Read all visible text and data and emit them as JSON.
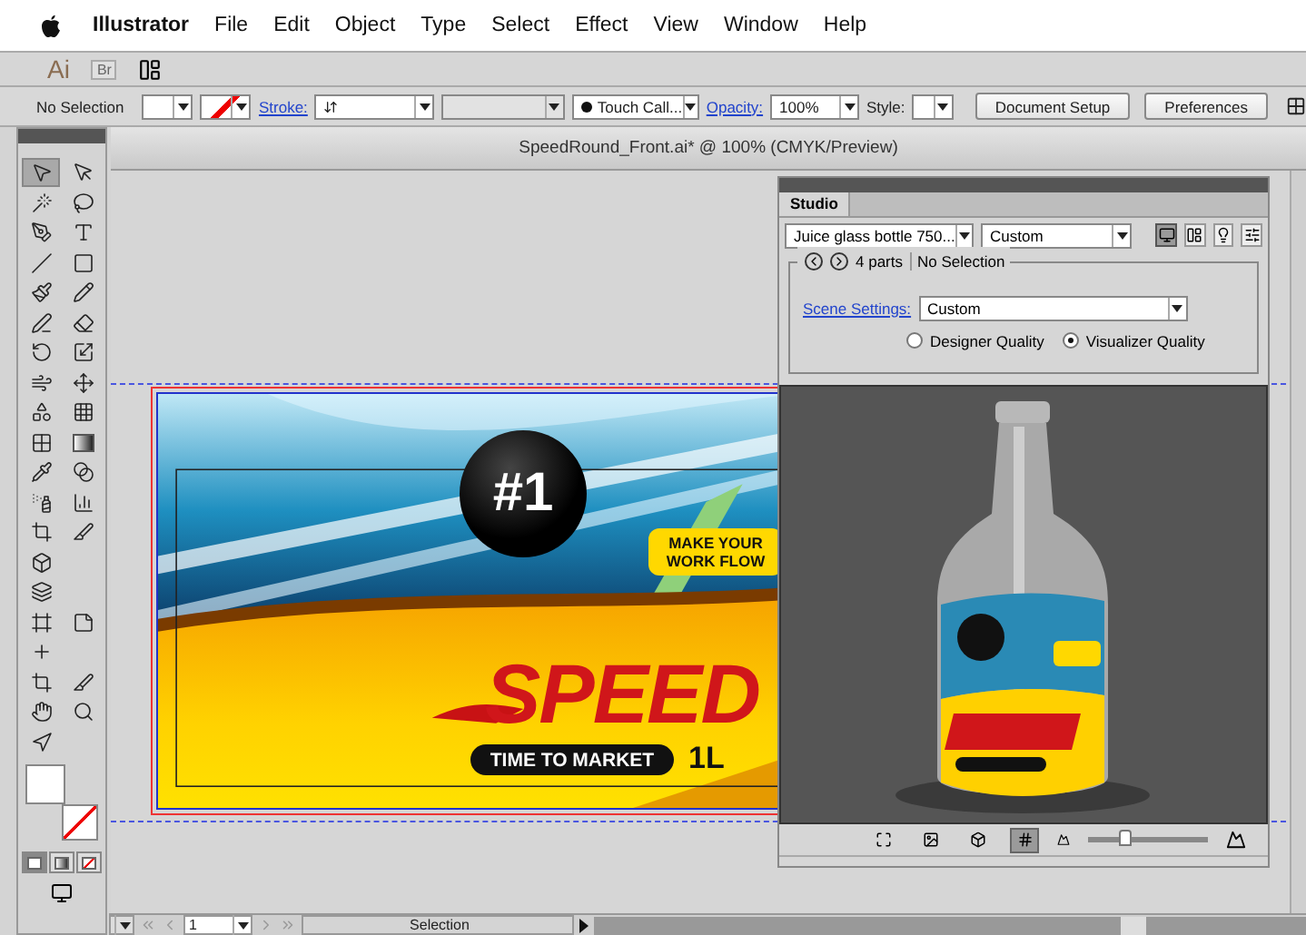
{
  "menu_bar": {
    "app_name": "Illustrator",
    "items": [
      "File",
      "Edit",
      "Object",
      "Type",
      "Select",
      "Effect",
      "View",
      "Window",
      "Help"
    ]
  },
  "app_bar": {
    "logo": "Ai",
    "bridge": "Br"
  },
  "control_bar": {
    "selection": "No Selection",
    "stroke_label": "Stroke:",
    "brush": "Touch Call...",
    "opacity_label": "Opacity:",
    "opacity": "100%",
    "style_label": "Style:",
    "buttons": [
      "Document Setup",
      "Preferences"
    ]
  },
  "tools": [
    {
      "tools": [
        {
          "kind": "selection",
          "selected": true
        },
        {
          "kind": "direct-selection",
          "selected": false
        }
      ]
    },
    {
      "tools": [
        {
          "kind": "magic-wand",
          "selected": false
        },
        {
          "kind": "lasso",
          "selected": false
        }
      ]
    },
    {
      "tools": [
        {
          "kind": "pen",
          "selected": false
        },
        {
          "kind": "type",
          "selected": false
        }
      ]
    },
    {
      "tools": [
        {
          "kind": "line",
          "selected": false
        },
        {
          "kind": "rectangle",
          "selected": false
        }
      ]
    },
    {
      "tools": [
        {
          "kind": "paintbrush",
          "selected": false
        },
        {
          "kind": "pencil",
          "selected": false
        }
      ]
    },
    {
      "tools": [
        {
          "kind": "blob-brush",
          "selected": false
        },
        {
          "kind": "eraser",
          "selected": false
        }
      ]
    },
    {
      "tools": [
        {
          "kind": "rotate",
          "selected": false
        },
        {
          "kind": "scale",
          "selected": false
        }
      ]
    },
    {
      "tools": [
        {
          "kind": "warp",
          "selected": false
        },
        {
          "kind": "free-transform",
          "selected": false
        }
      ]
    },
    {
      "tools": [
        {
          "kind": "shape-builder",
          "selected": false
        },
        {
          "kind": "perspective",
          "selected": false
        }
      ]
    },
    {
      "tools": [
        {
          "kind": "mesh",
          "selected": false
        },
        {
          "kind": "gradient",
          "selected": false
        }
      ]
    },
    {
      "tools": [
        {
          "kind": "eyedropper",
          "selected": false
        },
        {
          "kind": "blend",
          "selected": false
        }
      ]
    },
    {
      "tools": [
        {
          "kind": "symbol-sprayer",
          "selected": false
        },
        {
          "kind": "graph",
          "selected": false
        }
      ]
    },
    {
      "tools": [
        {
          "kind": "artboard-select",
          "selected": false
        },
        {
          "kind": "slice",
          "selected": false
        }
      ]
    },
    {
      "tools": [
        {
          "kind": "cube",
          "selected": false
        }
      ]
    },
    {
      "tools": [
        {
          "kind": "layers",
          "selected": false
        }
      ]
    },
    {
      "tools": [
        {
          "kind": "frame",
          "selected": false
        },
        {
          "kind": "note",
          "selected": false
        }
      ]
    },
    {
      "tools": [
        {
          "kind": "plus",
          "selected": false
        }
      ]
    },
    {
      "tools": [
        {
          "kind": "artboard",
          "selected": false
        },
        {
          "kind": "knife",
          "selected": false
        }
      ]
    },
    {
      "tools": [
        {
          "kind": "hand",
          "selected": false
        },
        {
          "kind": "zoom",
          "selected": false
        }
      ]
    },
    {
      "tools": [
        {
          "kind": "touch",
          "selected": false
        }
      ]
    }
  ],
  "draw_modes": [
    {
      "kind": "normal",
      "selected": true
    },
    {
      "kind": "behind",
      "selected": false
    },
    {
      "kind": "inside",
      "selected": false
    }
  ],
  "document": {
    "tab": "SpeedRound_Front.ai* @ 100% (CMYK/Preview)",
    "artwork": {
      "badge": "#1",
      "tagline": [
        "MAKE YOUR",
        "WORK FLOW"
      ],
      "brand": "SPEED",
      "slogan": "TIME TO MARKET",
      "volume": "1L"
    }
  },
  "studio": {
    "tab": "Studio",
    "model": "Juice glass bottle 750...",
    "preset": "Custom",
    "view_buttons": [
      {
        "kind": "render",
        "selected": true
      },
      {
        "kind": "parts",
        "selected": false
      },
      {
        "kind": "lights",
        "selected": false
      },
      {
        "kind": "settings",
        "selected": false
      }
    ],
    "parts": "4 parts",
    "selection": "No Selection",
    "scene_label": "Scene Settings:",
    "scene": "Custom",
    "quality": [
      {
        "label": "Designer Quality",
        "selected": false
      },
      {
        "label": "Visualizer Quality",
        "selected": true
      }
    ],
    "bottom_tools": [
      {
        "kind": "fit",
        "selected": false
      },
      {
        "kind": "background",
        "selected": false
      },
      {
        "kind": "box",
        "selected": false
      },
      {
        "kind": "grid",
        "selected": true
      }
    ],
    "zoom": {
      "level": 0.3
    }
  },
  "status_bar": {
    "page": "1",
    "tool": "Selection"
  }
}
